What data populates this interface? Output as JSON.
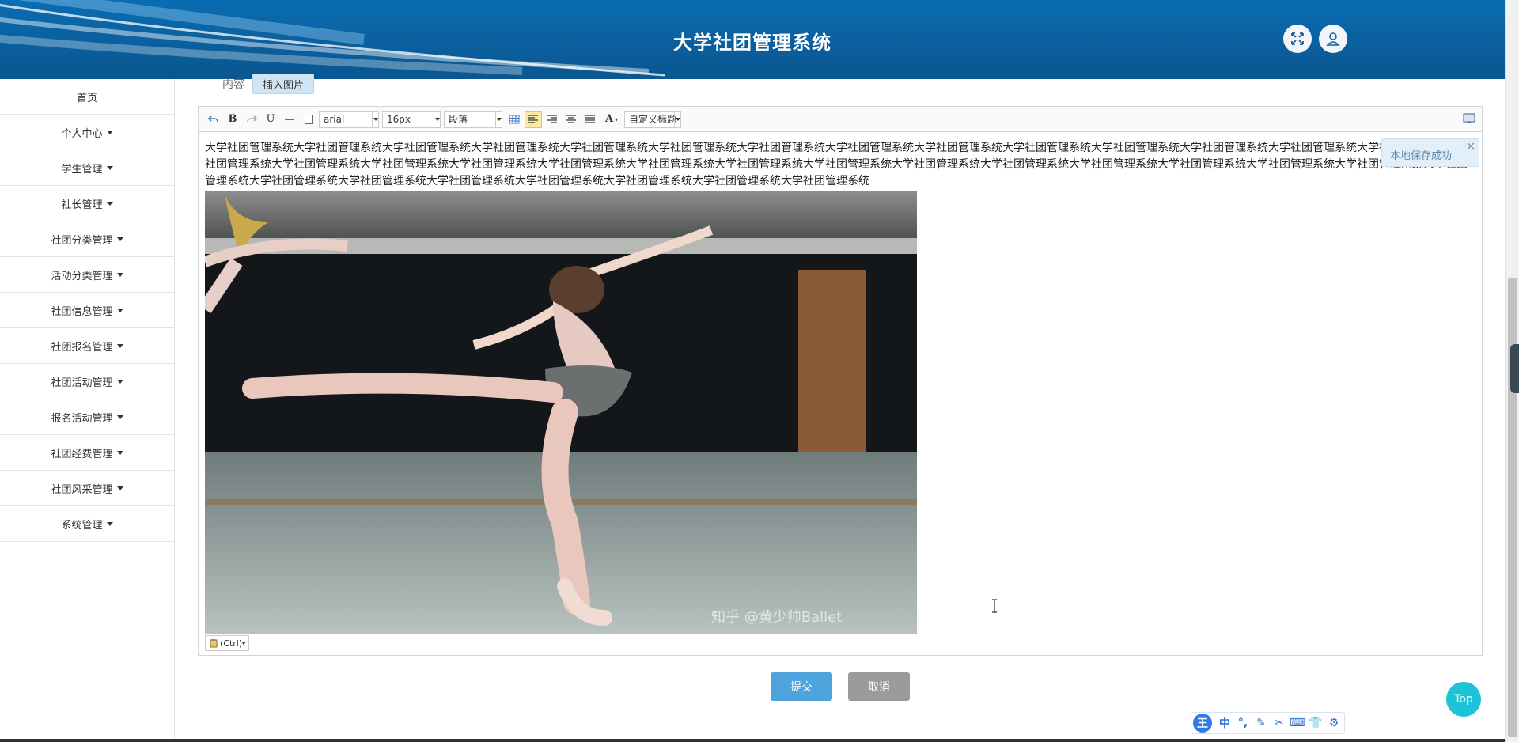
{
  "header": {
    "title": "大学社团管理系统"
  },
  "sidebar": {
    "items": [
      {
        "label": "首页",
        "caret": false
      },
      {
        "label": "个人中心",
        "caret": true
      },
      {
        "label": "学生管理",
        "caret": true
      },
      {
        "label": "社长管理",
        "caret": true
      },
      {
        "label": "社团分类管理",
        "caret": true
      },
      {
        "label": "活动分类管理",
        "caret": true
      },
      {
        "label": "社团信息管理",
        "caret": true
      },
      {
        "label": "社团报名管理",
        "caret": true
      },
      {
        "label": "社团活动管理",
        "caret": true
      },
      {
        "label": "报名活动管理",
        "caret": true
      },
      {
        "label": "社团经费管理",
        "caret": true
      },
      {
        "label": "社团风采管理",
        "caret": true
      },
      {
        "label": "系统管理",
        "caret": true
      }
    ]
  },
  "tabs": {
    "content_label": "内容",
    "insert_image_label": "插入图片"
  },
  "toolbar": {
    "font_family": "arial",
    "font_size": "16px",
    "paragraph": "段落",
    "custom_heading": "自定义标题",
    "font_color_label": "A"
  },
  "editor": {
    "text": "大学社团管理系统大学社团管理系统大学社团管理系统大学社团管理系统大学社团管理系统大学社团管理系统大学社团管理系统大学社团管理系统大学社团管理系统大学社团管理系统大学社团管理系统大学社团管理系统大学社团管理系统大学社团管理系统大学社团管理系统大学社团管理系统大学社团管理系统大学社团管理系统大学社团管理系统大学社团管理系统大学社团管理系统大学社团管理系统大学社团管理系统大学社团管理系统大学社团管理系统大学社团管理系统大学社团管理系统大学社团管理系统大学社团管理系统大学社团管理系统大学社团管理系统大学社团管理系统大学社团管理系统大学社团管理系统大学社团管理系统大学社团管理系统",
    "photo_watermark": "知乎 @黄少帅Ballet",
    "paste_label": "(Ctrl)"
  },
  "toast": {
    "message": "本地保存成功",
    "close": "×"
  },
  "actions": {
    "submit": "提交",
    "cancel": "取消"
  },
  "top_button": "Top",
  "ime": {
    "logo": "王",
    "mode": "中"
  },
  "colors": {
    "header": "#0b5e9c",
    "submit": "#4fa3dd",
    "cancel": "#9b9b9b",
    "top": "#1dc3d6"
  }
}
